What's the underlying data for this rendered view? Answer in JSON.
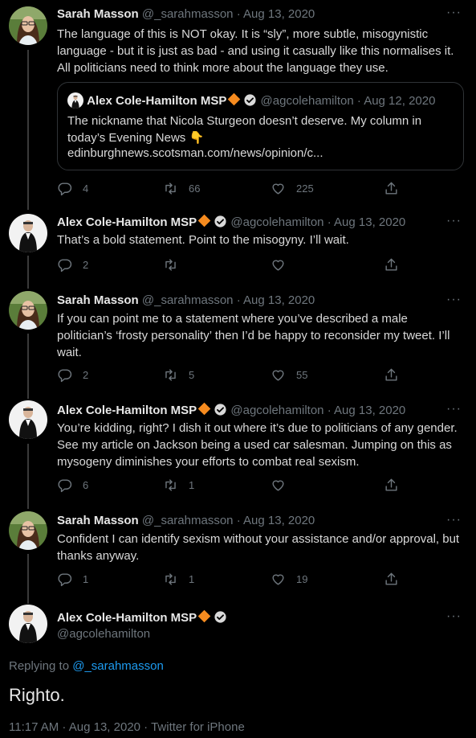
{
  "tweets": [
    {
      "name": "Sarah Masson",
      "handle": "@_sarahmasson",
      "date": "Aug 13, 2020",
      "text": "The language of this is NOT okay. It is “sly”, more subtle, misogynistic language - but it is just as bad - and using it casually like this normalises it. All politicians need to think more about the language they use.",
      "quote": {
        "name": "Alex Cole-Hamilton MSP",
        "handle": "@agcolehamilton",
        "date": "Aug 12, 2020",
        "text": "The nickname that Nicola Sturgeon doesn’t deserve. My column in today’s Evening News 👇",
        "link": "edinburghnews.scotsman.com/news/opinion/c..."
      },
      "replies": "4",
      "retweets": "66",
      "likes": "225"
    },
    {
      "name": "Alex Cole-Hamilton MSP",
      "handle": "@agcolehamilton",
      "date": "Aug 13, 2020",
      "text": "That’s a bold statement. Point to the misogyny. I’ll wait.",
      "replies": "2",
      "retweets": "",
      "likes": ""
    },
    {
      "name": "Sarah Masson",
      "handle": "@_sarahmasson",
      "date": "Aug 13, 2020",
      "text": "If you can point me to a statement where you’ve described a male politician’s ‘frosty personality’ then I’d be happy to reconsider my tweet. I’ll wait.",
      "replies": "2",
      "retweets": "5",
      "likes": "55"
    },
    {
      "name": "Alex Cole-Hamilton MSP",
      "handle": "@agcolehamilton",
      "date": "Aug 13, 2020",
      "text": "You’re kidding, right? I dish it out where it’s due to politicians of any gender. See my article on Jackson being a used car salesman. Jumping on this as mysogeny diminishes your efforts to combat real sexism.",
      "replies": "6",
      "retweets": "1",
      "likes": ""
    },
    {
      "name": "Sarah Masson",
      "handle": "@_sarahmasson",
      "date": "Aug 13, 2020",
      "text": "Confident I can identify sexism without your assistance and/or approval, but thanks anyway.",
      "replies": "1",
      "retweets": "1",
      "likes": "19"
    }
  ],
  "main": {
    "name": "Alex Cole-Hamilton MSP",
    "handle": "@agcolehamilton",
    "replying_prefix": "Replying to",
    "replying_handle": "@_sarahmasson",
    "text": "Righto.",
    "meta": "11:17 AM · Aug 13, 2020 · Twitter for iPhone"
  },
  "sep": "·",
  "more_glyph": "···",
  "icons": [
    "reply-icon",
    "retweet-icon",
    "like-icon",
    "share-icon",
    "verified-icon",
    "more-icon"
  ],
  "colors": {
    "background": "#000000",
    "muted": "#6e767d",
    "link": "#1d9bf0",
    "badge": "#f68b1f"
  }
}
